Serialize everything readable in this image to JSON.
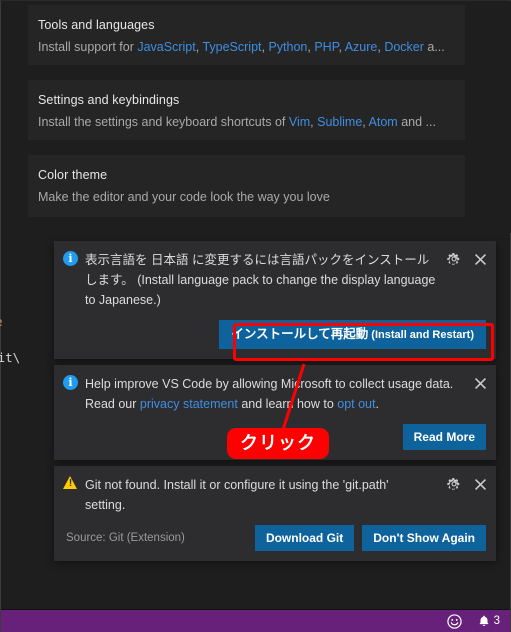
{
  "app": {
    "name": "Visual Studio Code"
  },
  "editor_background": {
    "code_fragment_1": "e",
    "code_fragment_2": "s\\Git\\"
  },
  "welcome": {
    "cards": [
      {
        "title": "Tools and languages",
        "desc_prefix": "Install support for ",
        "links": [
          "JavaScript",
          "TypeScript",
          "Python",
          "PHP",
          "Azure",
          "Docker"
        ],
        "desc_suffix": " a..."
      },
      {
        "title": "Settings and keybindings",
        "desc_prefix": "Install the settings and keyboard shortcuts of ",
        "links": [
          "Vim",
          "Sublime",
          "Atom"
        ],
        "desc_suffix": " and ..."
      },
      {
        "title": "Color theme",
        "desc_prefix": "Make the editor and your code look the way you love",
        "links": [],
        "desc_suffix": ""
      }
    ]
  },
  "notifications": [
    {
      "severity": "info",
      "severity_icon": "info-icon",
      "message_line1": "表示言語を 日本語 に変更するには言語パックをインストール",
      "message_line2": "します。 (Install language pack to change the display language",
      "message_line3": "to Japanese.)",
      "gear_icon": "gear-icon",
      "close_icon": "close-icon",
      "primary_button_jp": "インストールして再起動",
      "primary_button_en": " (Install and Restart)",
      "source": ""
    },
    {
      "severity": "info",
      "severity_icon": "info-icon",
      "message_line1": "Help improve VS Code by allowing Microsoft to collect usage data.",
      "line2_prefix": "Read our ",
      "line2_link1": "privacy statement",
      "line2_middle": " and learn how to ",
      "line2_link2": "opt out",
      "line2_suffix": ".",
      "close_icon": "close-icon",
      "button": "Read More",
      "source": ""
    },
    {
      "severity": "warning",
      "severity_icon": "warning-icon",
      "message_line1": "Git not found. Install it or configure it using the 'git.path'",
      "message_line2": "setting.",
      "gear_icon": "gear-icon",
      "close_icon": "close-icon",
      "source": "Source: Git (Extension)",
      "button_primary": "Download Git",
      "button_secondary": "Don't Show Again"
    }
  ],
  "annotation": {
    "bubble_text": "クリック",
    "highlight_color": "#ff0000",
    "arrow_color": "#ff0000"
  },
  "statusbar": {
    "background": "#68217a",
    "smiley_icon": "smiley-feedback-icon",
    "bell_icon": "bell-notification-icon",
    "notification_count": "3"
  },
  "colors": {
    "editor_bg": "#1e1e1e",
    "card_bg": "#252526",
    "toast_bg": "#2d2d30",
    "link": "#3f8ee0",
    "button_bg": "#0e639c",
    "info_icon": "#1f9cf0",
    "warn_icon": "#ffcc00"
  }
}
